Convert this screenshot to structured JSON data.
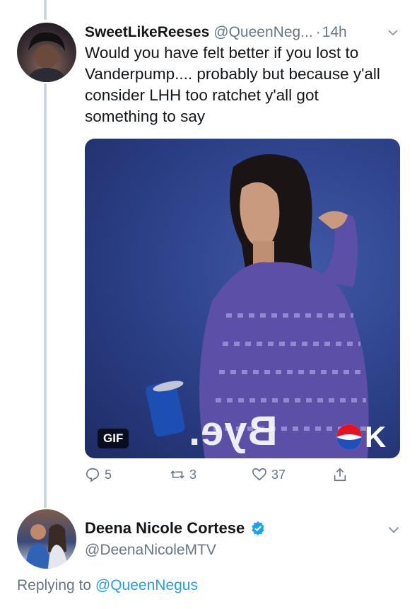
{
  "tweet1": {
    "name": "SweetLikeReeses",
    "handle": "@QueenNeg...",
    "separator": "·",
    "time": "14h",
    "text": "Would you have felt better if you lost to Vanderpump.... probably but because y'all consider LHH too ratchet y'all got something to say",
    "media": {
      "overlay_text": "Bye.",
      "badge": "GIF",
      "logo_text": "K"
    },
    "actions": {
      "reply_count": "5",
      "retweet_count": "3",
      "like_count": "37"
    }
  },
  "tweet2": {
    "name": "Deena Nicole Cortese",
    "handle": "@DeenaNicoleMTV",
    "replying_prefix": "Replying to",
    "replying_handle": "@QueenNegus"
  },
  "icons": {
    "reply": "reply-icon",
    "retweet": "retweet-icon",
    "like": "heart-icon",
    "share": "share-icon",
    "verified": "verified-badge-icon",
    "more": "chevron-down-icon"
  },
  "colors": {
    "link": "#1da1f2",
    "muted": "#657786",
    "thread_line": "#ccd6dd"
  }
}
